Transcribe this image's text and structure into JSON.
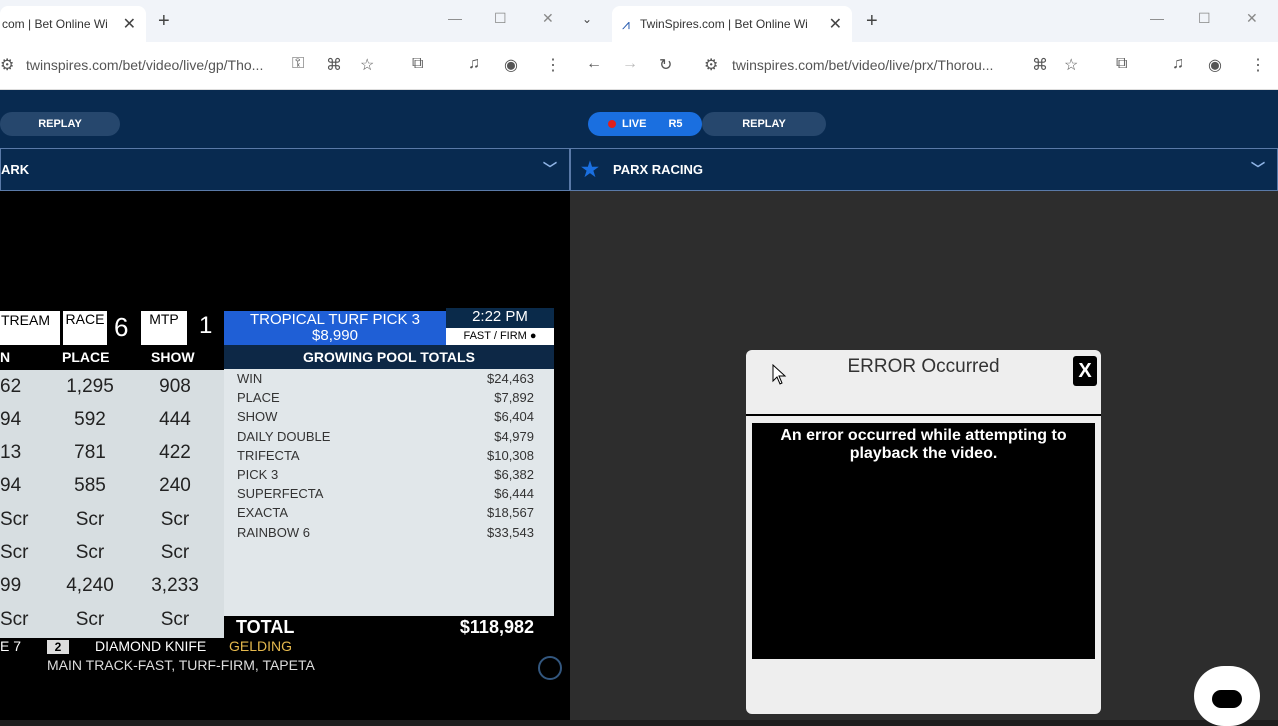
{
  "left_window": {
    "tab_title": "com | Bet Online Wi",
    "url": "twinspires.com/bet/video/live/gp/Tho...",
    "replay_label": "REPLAY",
    "track_name": "ARK",
    "toteboard": {
      "stream_label": "TREAM",
      "race_label": "RACE",
      "race_number": "6",
      "mtp_label": "MTP",
      "mtp_value": "1",
      "pick_title": "TROPICAL TURF PICK 3",
      "pick_amount": "$8,990",
      "post_time": "2:22 PM",
      "conditions": "FAST / FIRM ●",
      "pool_header": "GROWING POOL TOTALS",
      "col_headers": {
        "win": "N",
        "place": "PLACE",
        "show": "SHOW"
      },
      "rows": [
        {
          "win": "62",
          "place": "1,295",
          "show": "908"
        },
        {
          "win": "94",
          "place": "592",
          "show": "444"
        },
        {
          "win": "13",
          "place": "781",
          "show": "422"
        },
        {
          "win": "94",
          "place": "585",
          "show": "240"
        },
        {
          "win": "Scr",
          "place": "Scr",
          "show": "Scr"
        },
        {
          "win": "Scr",
          "place": "Scr",
          "show": "Scr"
        },
        {
          "win": "99",
          "place": "4,240",
          "show": "3,233"
        },
        {
          "win": "Scr",
          "place": "Scr",
          "show": "Scr"
        }
      ],
      "pools": [
        {
          "name": "WIN",
          "amount": "$24,463"
        },
        {
          "name": "PLACE",
          "amount": "$7,892"
        },
        {
          "name": "SHOW",
          "amount": "$6,404"
        },
        {
          "name": "DAILY DOUBLE",
          "amount": "$4,979"
        },
        {
          "name": "TRIFECTA",
          "amount": "$10,308"
        },
        {
          "name": "PICK 3",
          "amount": "$6,382"
        },
        {
          "name": "SUPERFECTA",
          "amount": "$6,444"
        },
        {
          "name": "EXACTA",
          "amount": "$18,567"
        },
        {
          "name": "RAINBOW 6",
          "amount": "$33,543"
        }
      ],
      "total_label": "TOTAL",
      "total_value": "$118,982",
      "bottom_race": "E 7",
      "bottom_horse_num": "2",
      "bottom_horse": "DIAMOND KNIFE",
      "bottom_sex": "GELDING",
      "bottom_track": "MAIN TRACK-FAST, TURF-FIRM, TAPETA"
    }
  },
  "right_window": {
    "tab_title": "TwinSpires.com | Bet Online Wi",
    "url": "twinspires.com/bet/video/live/prx/Thorou...",
    "live_label": "LIVE",
    "race_label": "R5",
    "replay_label": "REPLAY",
    "track_name": "PARX RACING",
    "modal": {
      "title": "ERROR Occurred",
      "close_label": "X",
      "message": "An error occurred while attempting to playback the video."
    }
  }
}
